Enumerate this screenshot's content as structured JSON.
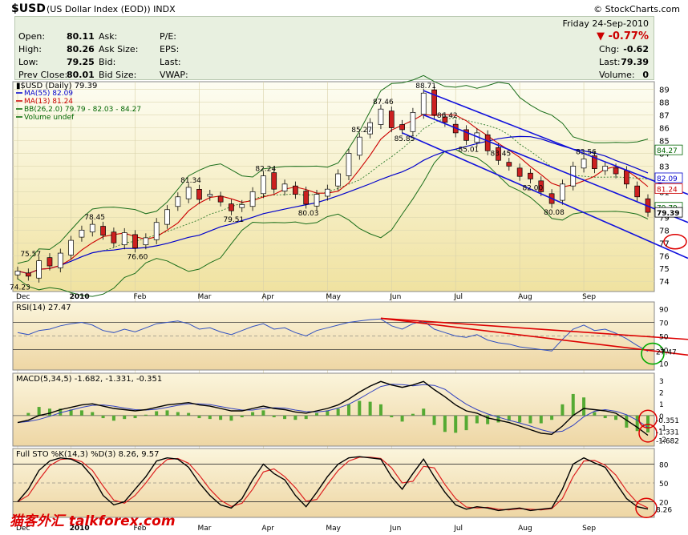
{
  "header": {
    "symbol": "$USD",
    "description": "(US Dollar Index (EOD))",
    "exchange": "INDX",
    "logo": "© StockCharts.com"
  },
  "quote": {
    "day_date": "Friday   24-Sep-2010",
    "open_label": "Open:",
    "open": "80.11",
    "high_label": "High:",
    "high": "80.26",
    "low_label": "Low:",
    "low": "79.25",
    "prev_label": "Prev Close:",
    "prev": "80.01",
    "ask_label": "Ask:",
    "ask_size_label": "Ask Size:",
    "bid_label": "Bid:",
    "bid_size_label": "Bid Size:",
    "pe_label": "P/E:",
    "eps_label": "EPS:",
    "last_label": "Last:",
    "vwap_label": "VWAP:",
    "pct_change": "▼ -0.77%",
    "chg_label": "Chg:",
    "chg": "-0.62",
    "last_label2": "Last:",
    "last": "79.39",
    "volume_label": "Volume:",
    "volume": "0"
  },
  "chart_data": [
    {
      "type": "candlestick",
      "title": "$USD (Daily) 79.39",
      "legend": [
        {
          "name": "MA(55) 82.09",
          "color": "#0000cc"
        },
        {
          "name": "MA(13) 81.24",
          "color": "#cc0000"
        },
        {
          "name": "BB(26,2.0) 79.79 - 82.03 - 84.27",
          "color": "#006600"
        },
        {
          "name": "Volume undef",
          "color": "#006600"
        }
      ],
      "y_ticks": [
        74,
        75,
        76,
        77,
        78,
        79,
        80,
        81,
        82,
        83,
        84,
        85,
        86,
        87,
        88,
        89
      ],
      "ylim": [
        73.2,
        89.6
      ],
      "x_labels": [
        "Dec",
        "2010",
        "Feb",
        "Mar",
        "Apr",
        "May",
        "Jun",
        "Jul",
        "Aug",
        "Sep"
      ],
      "close": [
        74.8,
        74.4,
        75.6,
        75.2,
        76.2,
        77.2,
        78.0,
        78.45,
        77.6,
        77.0,
        77.8,
        76.6,
        77.4,
        78.6,
        79.6,
        80.6,
        81.34,
        80.4,
        80.8,
        80.2,
        79.51,
        80.0,
        81.0,
        82.24,
        81.2,
        81.6,
        80.8,
        80.03,
        80.8,
        81.2,
        82.4,
        84.0,
        85.27,
        86.4,
        87.46,
        86.0,
        85.85,
        87.2,
        88.71,
        87.0,
        86.42,
        85.6,
        85.01,
        85.6,
        84.2,
        83.45,
        83.0,
        82.2,
        82.0,
        81.0,
        80.08,
        81.6,
        83.0,
        83.56,
        82.8,
        83.0,
        82.4,
        81.6,
        80.6,
        79.39
      ],
      "annotations": [
        "75.57",
        "74.23",
        "78.45",
        "76.60",
        "81.34",
        "79.51",
        "82.24",
        "80.03",
        "85.27",
        "87.46",
        "88.71",
        "85.85",
        "86.42",
        "85.01",
        "83.45",
        "82.00",
        "80.08",
        "83.56"
      ],
      "right_labels": [
        "84.27",
        "82.09",
        "81.24",
        "79.79",
        "79.39"
      ]
    },
    {
      "type": "line",
      "title": "RSI(14) 27.47",
      "y_ticks": [
        10,
        30,
        50,
        70,
        90
      ],
      "ylim": [
        0,
        100
      ],
      "values": [
        55,
        52,
        58,
        60,
        65,
        68,
        70,
        66,
        58,
        55,
        60,
        56,
        62,
        68,
        70,
        72,
        68,
        60,
        62,
        56,
        52,
        58,
        64,
        68,
        60,
        62,
        55,
        50,
        58,
        62,
        66,
        70,
        72,
        74,
        75,
        65,
        60,
        68,
        72,
        60,
        55,
        50,
        48,
        52,
        44,
        40,
        38,
        34,
        32,
        30,
        28,
        45,
        60,
        66,
        58,
        60,
        54,
        46,
        36,
        27.47
      ],
      "right_label": "27.47"
    },
    {
      "type": "line",
      "title": "MACD(5,34,5) -1.682, -1.331, -0.351",
      "y_ticks": [
        -2,
        -1,
        0,
        1,
        2,
        3
      ],
      "ylim": [
        -2.6,
        3.6
      ],
      "macd": [
        -0.6,
        -0.4,
        0.0,
        0.2,
        0.5,
        0.7,
        0.9,
        1.0,
        0.8,
        0.6,
        0.5,
        0.4,
        0.5,
        0.7,
        0.9,
        1.0,
        1.1,
        0.9,
        0.8,
        0.6,
        0.4,
        0.4,
        0.6,
        0.8,
        0.6,
        0.5,
        0.3,
        0.2,
        0.4,
        0.6,
        0.9,
        1.4,
        2.0,
        2.5,
        2.9,
        2.6,
        2.4,
        2.6,
        2.9,
        2.2,
        1.6,
        0.9,
        0.4,
        0.2,
        -0.2,
        -0.4,
        -0.6,
        -0.9,
        -1.2,
        -1.5,
        -1.6,
        -0.9,
        0.0,
        0.6,
        0.5,
        0.4,
        0.2,
        -0.4,
        -1.0,
        -1.682
      ],
      "right_labels": [
        "-0.351",
        "-1.331",
        "-1.682"
      ]
    },
    {
      "type": "line",
      "title": "Full STO %K(14,3) %D(3) 8.26, 9.57",
      "y_ticks": [
        20,
        50,
        80
      ],
      "ylim": [
        -5,
        105
      ],
      "k": [
        20,
        40,
        70,
        85,
        90,
        88,
        80,
        60,
        30,
        15,
        20,
        40,
        60,
        85,
        90,
        88,
        75,
        50,
        30,
        15,
        10,
        25,
        55,
        80,
        65,
        55,
        30,
        12,
        35,
        60,
        80,
        90,
        92,
        90,
        88,
        60,
        40,
        65,
        88,
        60,
        35,
        15,
        8,
        12,
        10,
        6,
        8,
        10,
        6,
        8,
        10,
        40,
        80,
        90,
        82,
        75,
        50,
        25,
        12,
        8.26
      ],
      "right_label": "8.26"
    }
  ],
  "watermark": "猫客外汇 talkforex.com"
}
